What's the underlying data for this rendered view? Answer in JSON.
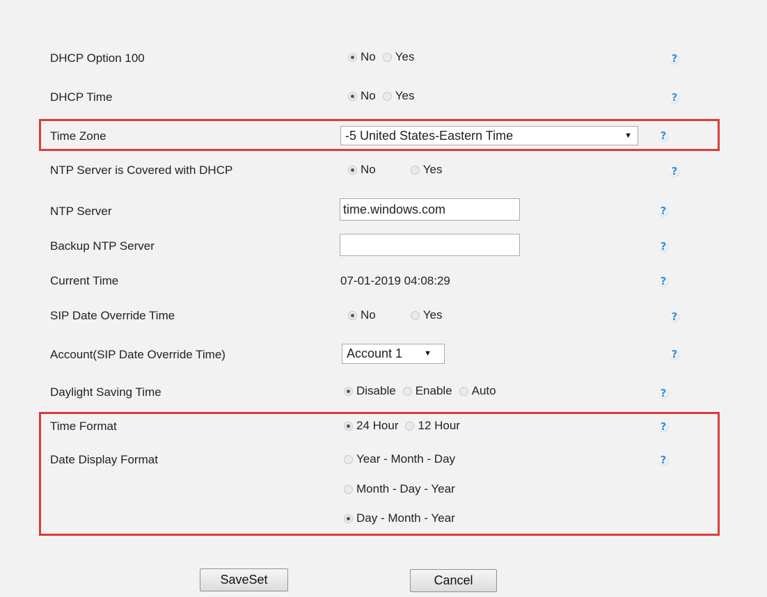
{
  "rows": {
    "dhcp_option_100": {
      "label": "DHCP Option 100",
      "options": [
        "No",
        "Yes"
      ],
      "selected": "No"
    },
    "dhcp_time": {
      "label": "DHCP Time",
      "options": [
        "No",
        "Yes"
      ],
      "selected": "No"
    },
    "time_zone": {
      "label": "Time Zone",
      "value": "-5 United States-Eastern Time"
    },
    "ntp_dhcp": {
      "label": "NTP Server is Covered with DHCP",
      "options": [
        "No",
        "Yes"
      ],
      "selected": "No"
    },
    "ntp_server": {
      "label": "NTP Server",
      "value": "time.windows.com"
    },
    "backup_ntp": {
      "label": "Backup NTP Server",
      "value": ""
    },
    "current_time": {
      "label": "Current Time",
      "value": "07-01-2019 04:08:29"
    },
    "sip_override": {
      "label": "SIP Date Override Time",
      "options": [
        "No",
        "Yes"
      ],
      "selected": "No"
    },
    "account_override": {
      "label": "Account(SIP Date Override Time)",
      "value": "Account 1"
    },
    "dst": {
      "label": "Daylight Saving Time",
      "options": [
        "Disable",
        "Enable",
        "Auto"
      ],
      "selected": "Disable"
    },
    "time_format": {
      "label": "Time Format",
      "options": [
        "24 Hour",
        "12 Hour"
      ],
      "selected": "24 Hour"
    },
    "date_format": {
      "label": "Date Display Format",
      "options": [
        "Year - Month - Day",
        "Month - Day - Year",
        "Day - Month - Year"
      ],
      "selected": "Day - Month - Year"
    }
  },
  "help_glyph": "?",
  "help_icon": "help-question-icon",
  "dropdown_arrow": "▼",
  "buttons": {
    "save": "SaveSet",
    "cancel": "Cancel"
  },
  "highlight_color": "#dc3b3b"
}
